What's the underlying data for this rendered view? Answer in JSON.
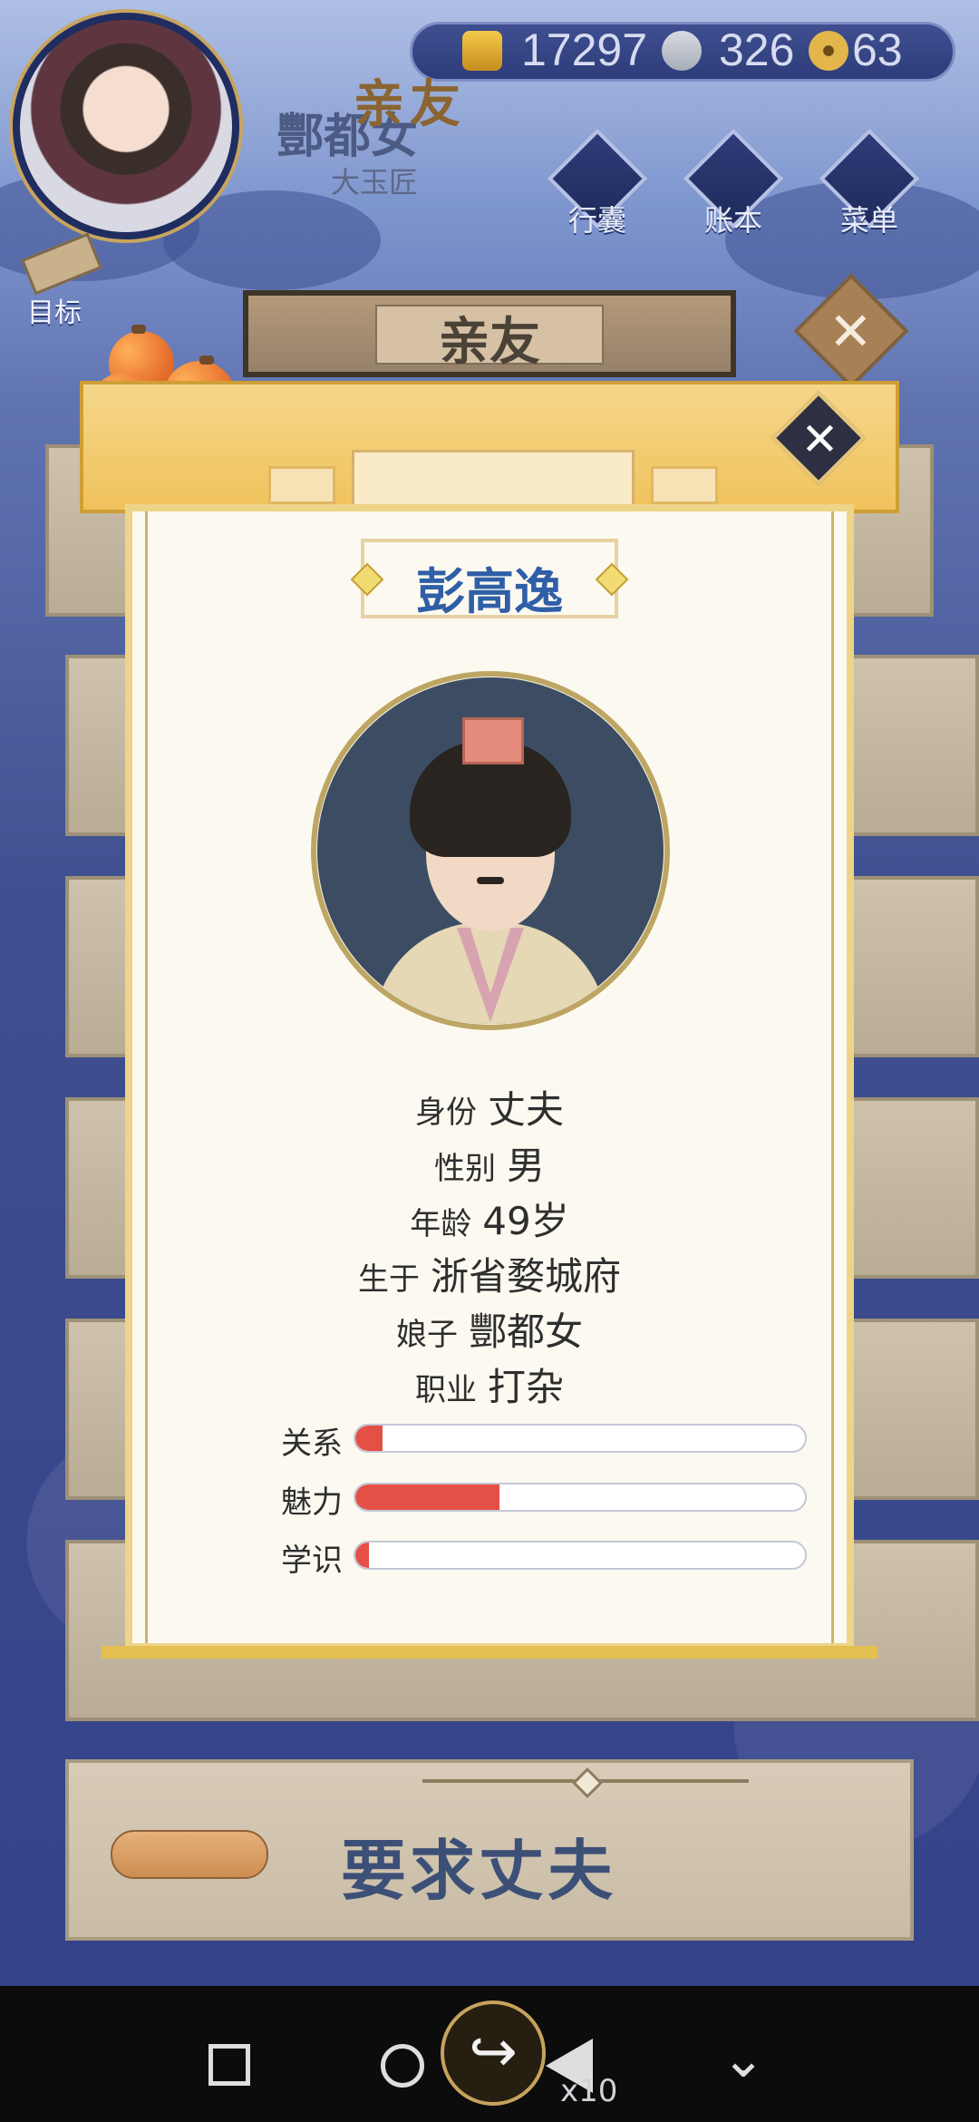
{
  "hud": {
    "player_name": "酆都女",
    "player_title": "大玉匠",
    "currency": {
      "gold": "17297",
      "silver": "326",
      "coin": "63"
    },
    "nav_buttons": [
      {
        "label": "行囊",
        "icon": "bag-icon"
      },
      {
        "label": "账本",
        "icon": "ledger-icon"
      },
      {
        "label": "菜单",
        "icon": "menu-icon"
      }
    ],
    "goal_label": "目标"
  },
  "screen": {
    "title": "亲友"
  },
  "modal": {
    "title": "亲友",
    "person_name": "彭高逸",
    "info": [
      {
        "key": "身份",
        "value": "丈夫"
      },
      {
        "key": "性别",
        "value": "男"
      },
      {
        "key": "年龄",
        "value": "49岁"
      },
      {
        "key": "生于",
        "value": "浙省婺城府"
      },
      {
        "key": "娘子",
        "value": "酆都女"
      },
      {
        "key": "职业",
        "value": "打杂"
      }
    ],
    "stats": [
      {
        "label": "关系",
        "value": 0.06
      },
      {
        "label": "魅力",
        "value": 0.32
      },
      {
        "label": "学识",
        "value": 0.03
      }
    ],
    "colors": {
      "accent": "#f0c25c",
      "name": "#2f5fa6",
      "bar_fill": "#e44f46"
    }
  },
  "action": {
    "label": "要求丈夫"
  },
  "system": {
    "overlay_count": "x10"
  }
}
